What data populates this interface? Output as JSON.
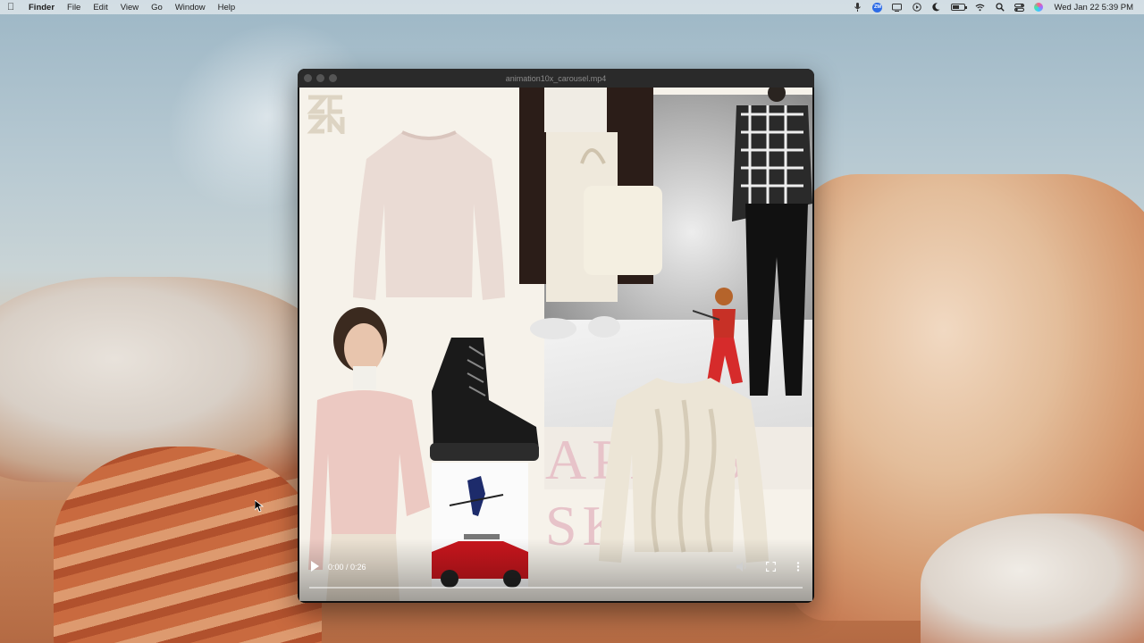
{
  "menubar": {
    "app_name": "Finder",
    "items": [
      "File",
      "Edit",
      "View",
      "Go",
      "Window",
      "Help"
    ],
    "status_icons": [
      "microphone-icon",
      "zoom-icon",
      "screen-mirror-icon",
      "play-circle-icon",
      "moon-icon",
      "battery-icon",
      "wifi-icon",
      "search-icon",
      "control-center-icon",
      "siri-icon"
    ],
    "zoom_badge": "ZM",
    "battery_level": 0.55,
    "clock": "Wed Jan 22  5:39 PM"
  },
  "window": {
    "title": "animation10x_carousel.mp4"
  },
  "video": {
    "logo_text": "ZC\nZN",
    "overlay_text": "APRÈS SK",
    "time_display": "0:00 / 0:26",
    "progress": 0.0
  },
  "colors": {
    "accent_zoom": "#2d6be6",
    "overlay_pink": "#e7c3c9",
    "video_bg": "#f6f2ea"
  }
}
